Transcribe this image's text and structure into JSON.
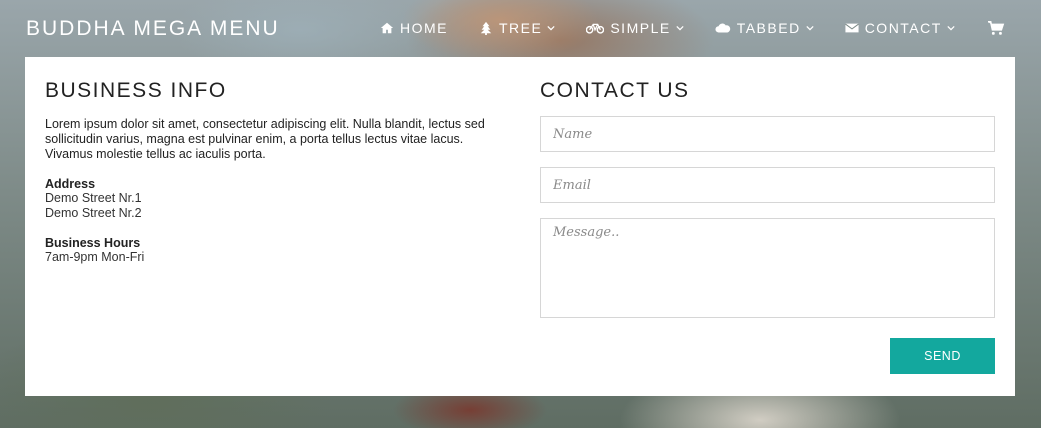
{
  "brand": {
    "name": "BUDDHA MEGA MENU"
  },
  "nav": {
    "items": [
      {
        "label": "HOME",
        "icon": "home-icon",
        "has_dropdown": false
      },
      {
        "label": "TREE",
        "icon": "tree-icon",
        "has_dropdown": true
      },
      {
        "label": "SIMPLE",
        "icon": "bicycle-icon",
        "has_dropdown": true
      },
      {
        "label": "TABBED",
        "icon": "cloud-icon",
        "has_dropdown": true
      },
      {
        "label": "CONTACT",
        "icon": "envelope-icon",
        "has_dropdown": true
      }
    ],
    "cart_icon": "cart-icon"
  },
  "business": {
    "title": "BUSINESS INFO",
    "intro": "Lorem ipsum dolor sit amet, consectetur adipiscing elit. Nulla blandit, lectus sed sollicitudin varius, magna est pulvinar enim, a porta tellus lectus vitae lacus. Vivamus molestie tellus ac iaculis porta.",
    "address_label": "Address",
    "address_lines": [
      "Demo Street Nr.1",
      "Demo Street Nr.2"
    ],
    "hours_label": "Business Hours",
    "hours": "7am-9pm Mon-Fri"
  },
  "contact": {
    "title": "CONTACT US",
    "name_placeholder": "Name",
    "email_placeholder": "Email",
    "message_placeholder": "Message..",
    "send_label": "SEND"
  },
  "colors": {
    "accent": "#13a89e",
    "panel_bg": "#ffffff",
    "text": "#222222"
  }
}
